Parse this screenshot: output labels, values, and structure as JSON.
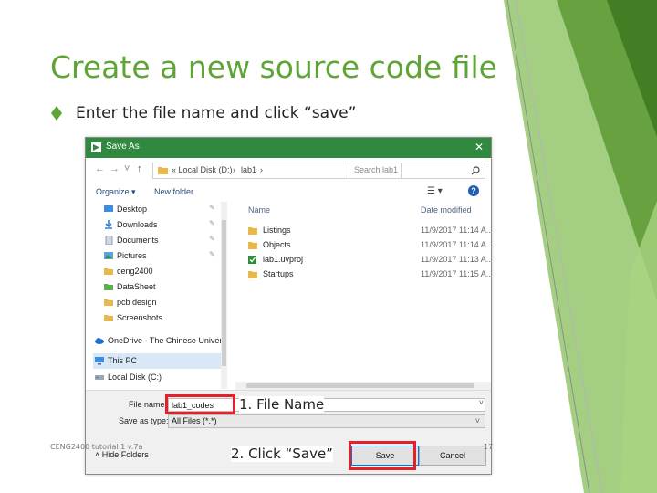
{
  "slide": {
    "title": "Create a new source code file",
    "bullet": "Enter the file name and click “save”",
    "footer": "CENG2400 tutorial 1 v.7a",
    "page_number": "17",
    "accent_color": "#5fa535"
  },
  "dialog": {
    "title": "Save As",
    "close_glyph": "✕",
    "nav": {
      "back": "←",
      "forward": "→",
      "recent": "˅",
      "up": "↑"
    },
    "breadcrumb": [
      "« Local Disk (D:)",
      "›",
      "lab1",
      "›"
    ],
    "search_placeholder": "Search lab1",
    "toolbar": {
      "organize": "Organize ▾",
      "new_folder": "New folder",
      "views_glyph": "☰ ▾",
      "help_glyph": "?"
    },
    "sidebar": [
      {
        "label": "Desktop",
        "icon": "desktop-icon",
        "pinned": true
      },
      {
        "label": "Downloads",
        "icon": "download-icon",
        "pinned": true
      },
      {
        "label": "Documents",
        "icon": "documents-icon",
        "pinned": true
      },
      {
        "label": "Pictures",
        "icon": "pictures-icon",
        "pinned": true
      },
      {
        "label": "ceng2400",
        "icon": "folder-icon",
        "pinned": false
      },
      {
        "label": "DataSheet",
        "icon": "folder-icon",
        "pinned": false
      },
      {
        "label": "pcb design",
        "icon": "folder-icon",
        "pinned": false
      },
      {
        "label": "Screenshots",
        "icon": "folder-icon",
        "pinned": false
      },
      {
        "label": "OneDrive - The Chinese Univer",
        "icon": "onedrive-icon",
        "pinned": false
      },
      {
        "label": "This PC",
        "icon": "computer-icon",
        "pinned": false,
        "selected": true
      },
      {
        "label": "Local Disk (C:)",
        "icon": "drive-icon",
        "pinned": false
      }
    ],
    "pin_glyph": "📌",
    "columns": {
      "name": "Name",
      "date": "Date modified"
    },
    "files": [
      {
        "name": "Listings",
        "date": "11/9/2017 11:14 A...",
        "icon": "folder-icon"
      },
      {
        "name": "Objects",
        "date": "11/9/2017 11:14 A...",
        "icon": "folder-icon"
      },
      {
        "name": "lab1.uvproj",
        "date": "11/9/2017 11:13 A...",
        "icon": "project-file-icon"
      },
      {
        "name": "Startups",
        "date": "11/9/2017 11:15 A...",
        "icon": "folder-icon"
      }
    ],
    "file_name_label": "File name:",
    "file_name_value": "lab1_codes",
    "save_as_type_label": "Save as type:",
    "save_as_type_value": "All Files (*.*)",
    "dropdown_glyph": "˅",
    "hide_folders": "˄ Hide Folders",
    "save_button": "Save",
    "cancel_button": "Cancel"
  },
  "annotations": {
    "step1": "1. File Name",
    "step2": "2. Click “Save”",
    "highlight_color": "#e2212b"
  }
}
